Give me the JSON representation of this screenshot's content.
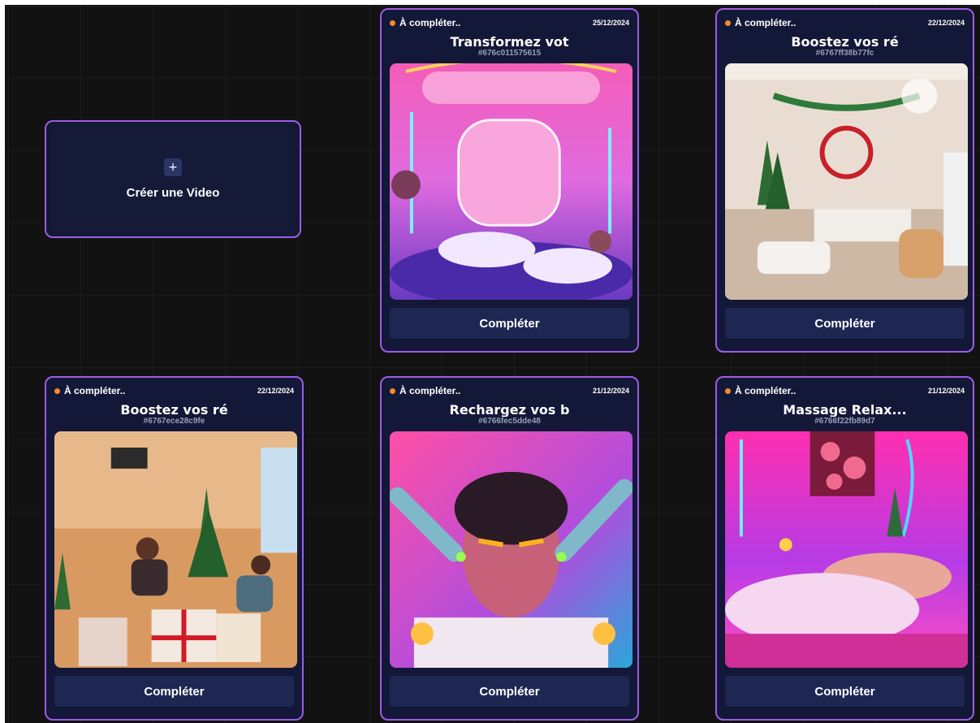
{
  "create": {
    "plus": "+",
    "label": "Créer une Video"
  },
  "cards": [
    {
      "status": "À compléter..",
      "date": "25/12/2024",
      "title": "Transformez vot",
      "ref": "#676c011575615",
      "button": "Compléter",
      "image": "pink-neon-spa-salon"
    },
    {
      "status": "À compléter..",
      "date": "22/12/2024",
      "title": "Boostez vos ré",
      "ref": "#6767ff38b77fc",
      "button": "Compléter",
      "image": "christmas-spa-room"
    },
    {
      "status": "À compléter..",
      "date": "22/12/2024",
      "title": "Boostez vos ré",
      "ref": "#6767ece28c9fe",
      "button": "Compléter",
      "image": "christmas-salon-gift-boxes"
    },
    {
      "status": "À compléter..",
      "date": "21/12/2024",
      "title": "Rechargez vos b",
      "ref": "#6766fec5dde48",
      "button": "Compléter",
      "image": "robotic-facial-treatment"
    },
    {
      "status": "À compléter..",
      "date": "21/12/2024",
      "title": "Massage Relax...",
      "ref": "#6766f22fb89d7",
      "button": "Compléter",
      "image": "neon-massage-room"
    }
  ],
  "colors": {
    "card_border": "#9b5de5",
    "card_bg": "#141838",
    "button_bg": "#1d2752",
    "status_dot": "#f08c2a"
  }
}
